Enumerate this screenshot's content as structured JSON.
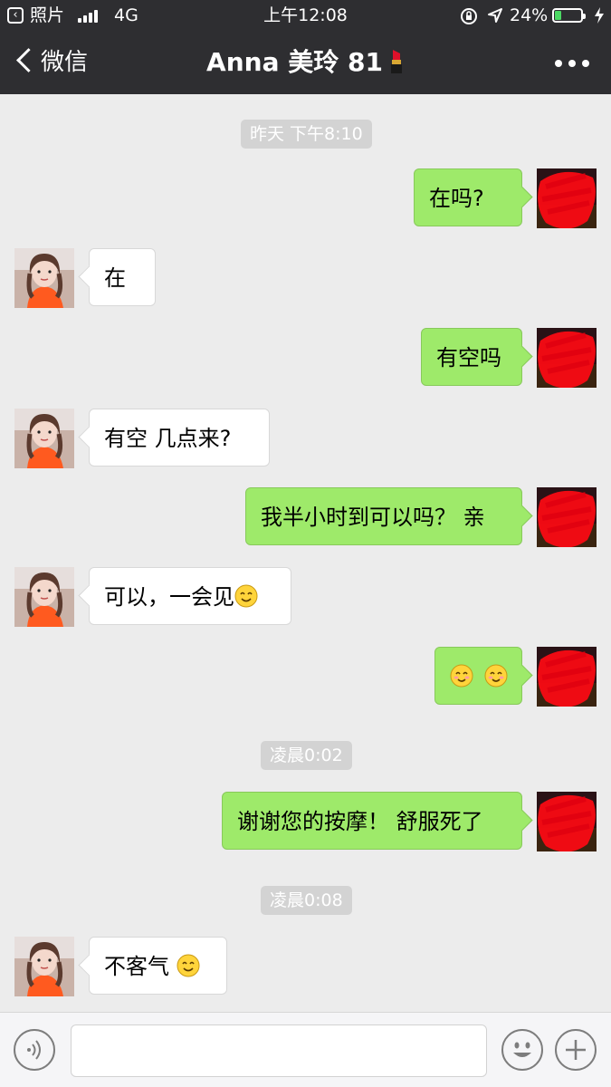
{
  "status_bar": {
    "back_app_label": "照片",
    "network": "4G",
    "time": "上午12:08",
    "battery_percent": "24%",
    "battery_level": 0.24
  },
  "navbar": {
    "back_label": "微信",
    "title": "Anna 美玲 81",
    "title_emoji": "lipstick-icon",
    "more_icon": "more-dots-icon"
  },
  "messages": [
    {
      "type": "time",
      "text": "昨天 下午8:10"
    },
    {
      "type": "message",
      "from": "me",
      "text": "在吗?"
    },
    {
      "type": "message",
      "from": "contact",
      "text": "在"
    },
    {
      "type": "message",
      "from": "me",
      "text": "有空吗"
    },
    {
      "type": "message",
      "from": "contact",
      "text": "有空 几点来?"
    },
    {
      "type": "message",
      "from": "me",
      "text": "我半小时到可以吗？ 亲"
    },
    {
      "type": "message",
      "from": "contact",
      "text": "可以，一会见",
      "emoji": "smile-emoji-icon"
    },
    {
      "type": "message",
      "from": "me",
      "text": "",
      "emoji": "blush-emoji-icon"
    },
    {
      "type": "time",
      "text": "凌晨0:02"
    },
    {
      "type": "message",
      "from": "me",
      "text": "谢谢您的按摩！ 舒服死了"
    },
    {
      "type": "time",
      "text": "凌晨0:08"
    },
    {
      "type": "message",
      "from": "contact",
      "text": "不客气 ",
      "emoji": "smile-emoji-icon"
    }
  ],
  "input_bar": {
    "voice_icon": "voice-icon",
    "emoji_icon": "emoji-face-icon",
    "plus_icon": "plus-icon",
    "placeholder": ""
  },
  "colors": {
    "header_bg": "#2e2e31",
    "chat_bg": "#ececec",
    "outgoing_bubble": "#9eea6a",
    "incoming_bubble": "#ffffff",
    "battery_fill": "#4cd964"
  }
}
